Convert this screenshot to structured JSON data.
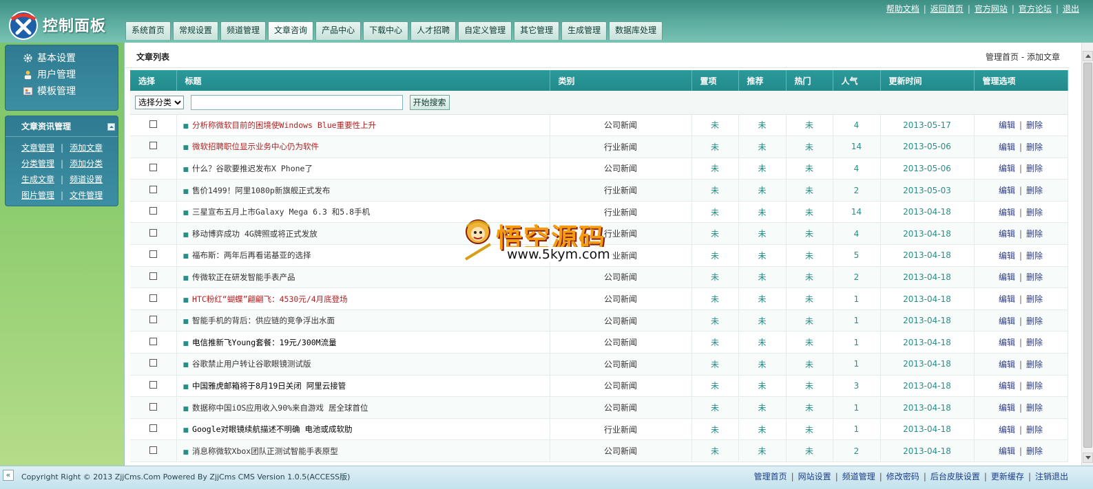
{
  "header": {
    "logo_text": "控制面板",
    "top_links": [
      "帮助文档",
      "返回首页",
      "官方网站",
      "官方论坛",
      "退出"
    ],
    "nav_tabs": [
      "系统首页",
      "常规设置",
      "频道管理",
      "文章咨询",
      "产品中心",
      "下载中心",
      "人才招聘",
      "自定义管理",
      "其它管理",
      "生成管理",
      "数据库处理"
    ],
    "active_tab_index": 3
  },
  "sidebar": {
    "main_items": [
      {
        "label": "基本设置",
        "icon": "gear-icon"
      },
      {
        "label": "用户管理",
        "icon": "user-icon"
      },
      {
        "label": "模板管理",
        "icon": "template-icon"
      }
    ],
    "section_title": "文章资讯管理",
    "links": [
      [
        "文章管理",
        "添加文章"
      ],
      [
        "分类管理",
        "添加分类"
      ],
      [
        "生成文章",
        "频道设置"
      ],
      [
        "图片管理",
        "文件管理"
      ]
    ]
  },
  "content": {
    "title": "文章列表",
    "crumb_home": "管理首页",
    "crumb_sep": " - ",
    "crumb_add": "添加文章"
  },
  "table": {
    "headers": [
      "选择",
      "标题",
      "类别",
      "置项",
      "推荐",
      "热门",
      "人气",
      "更新时间",
      "管理选项"
    ],
    "search": {
      "select_value": "选择分类",
      "input_value": "",
      "button_label": "开始搜索"
    },
    "edit_label": "编辑",
    "delete_label": "删除",
    "ops_sep": "|",
    "rows": [
      {
        "title": "分析称微软目前的困境使Windows Blue重要性上升",
        "title_color": "#b22222",
        "category": "公司新闻",
        "top": "未",
        "recommend": "未",
        "hot": "未",
        "views": "4",
        "date": "2013-05-17"
      },
      {
        "title": "微软招聘职位显示业务中心仍为软件",
        "title_color": "#b22222",
        "category": "行业新闻",
        "top": "未",
        "recommend": "未",
        "hot": "未",
        "views": "14",
        "date": "2013-05-06"
      },
      {
        "title": "什么？谷歌要推迟发布X Phone了",
        "title_color": "#333333",
        "category": "公司新闻",
        "top": "未",
        "recommend": "未",
        "hot": "未",
        "views": "4",
        "date": "2013-05-06"
      },
      {
        "title": "售价1499！阿里1080p新旗舰正式发布",
        "title_color": "#333333",
        "category": "行业新闻",
        "top": "未",
        "recommend": "未",
        "hot": "未",
        "views": "2",
        "date": "2013-05-03"
      },
      {
        "title": "三星宣布五月上市Galaxy Mega 6.3 和5.8手机",
        "title_color": "#333333",
        "category": "行业新闻",
        "top": "未",
        "recommend": "未",
        "hot": "未",
        "views": "14",
        "date": "2013-04-18"
      },
      {
        "title": "移动博弈成功 4G牌照或将正式发放",
        "title_color": "#333333",
        "category": "行业新闻",
        "top": "未",
        "recommend": "未",
        "hot": "未",
        "views": "4",
        "date": "2013-04-18"
      },
      {
        "title": "福布斯：两年后再看诺基亚的选择",
        "title_color": "#333333",
        "category": "行业新闻",
        "top": "未",
        "recommend": "未",
        "hot": "未",
        "views": "5",
        "date": "2013-04-18"
      },
      {
        "title": "传微软正在研发智能手表产品",
        "title_color": "#333333",
        "category": "公司新闻",
        "top": "未",
        "recommend": "未",
        "hot": "未",
        "views": "2",
        "date": "2013-04-18"
      },
      {
        "title": "HTC粉红“蝴蝶”翩翩飞：4530元/4月底登场",
        "title_color": "#b22222",
        "category": "公司新闻",
        "top": "未",
        "recommend": "未",
        "hot": "未",
        "views": "1",
        "date": "2013-04-18"
      },
      {
        "title": "智能手机的背后：供应链的竞争浮出水面",
        "title_color": "#333333",
        "category": "公司新闻",
        "top": "未",
        "recommend": "未",
        "hot": "未",
        "views": "1",
        "date": "2013-04-18"
      },
      {
        "title": "电信推新飞Young套餐：19元/300M流量",
        "title_color": "#000000",
        "category": "公司新闻",
        "top": "未",
        "recommend": "未",
        "hot": "未",
        "views": "1",
        "date": "2013-04-18"
      },
      {
        "title": "谷歌禁止用户转让谷歌眼镜测试版",
        "title_color": "#333333",
        "category": "公司新闻",
        "top": "未",
        "recommend": "未",
        "hot": "未",
        "views": "1",
        "date": "2013-04-18"
      },
      {
        "title": "中国雅虎邮箱将于8月19日关闭 阿里云接管",
        "title_color": "#000000",
        "category": "公司新闻",
        "top": "未",
        "recommend": "未",
        "hot": "未",
        "views": "3",
        "date": "2013-04-18"
      },
      {
        "title": "数据称中国iOS应用收入90%来自游戏 居全球首位",
        "title_color": "#333333",
        "category": "公司新闻",
        "top": "未",
        "recommend": "未",
        "hot": "未",
        "views": "1",
        "date": "2013-04-18"
      },
      {
        "title": "Google对眼镜续航描述不明确 电池或成软肋",
        "title_color": "#000000",
        "category": "行业新闻",
        "top": "未",
        "recommend": "未",
        "hot": "未",
        "views": "1",
        "date": "2013-04-18"
      },
      {
        "title": "消息称微软Xbox团队正测试智能手表原型",
        "title_color": "#333333",
        "category": "公司新闻",
        "top": "未",
        "recommend": "未",
        "hot": "未",
        "views": "2",
        "date": "2013-04-18"
      }
    ]
  },
  "watermark": {
    "text": "悟空源码",
    "url": "www.5kym.com"
  },
  "footer": {
    "toggle": "«",
    "copyright": "Copyright Right © 2013 ZjjCms.Com Powered By ZjjCms CMS Version 1.0.5(ACCESS版)",
    "links": [
      "管理首页",
      "网站设置",
      "频道管理",
      "修改密码",
      "后台皮肤设置",
      "更新缓存",
      "注销退出"
    ]
  },
  "colors": {
    "header_green": "#4e9e92",
    "table_header": "#2c9a9a",
    "sidebar_box": "#2f7b91",
    "highlight_title": "#b22222",
    "teal_text": "#2a8e86"
  }
}
